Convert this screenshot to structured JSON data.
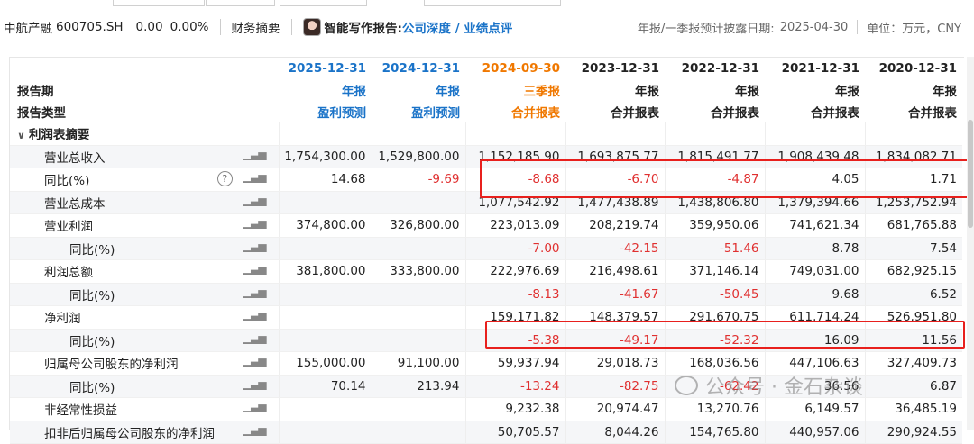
{
  "header": {
    "stock_name": "中航产融",
    "stock_code": "600705.SH",
    "price": "0.00",
    "change_pct": "0.00%",
    "summary_label": "财务摘要",
    "ai_report_label": "智能写作报告:",
    "ai_report_link": "公司深度 / 业绩点评",
    "disclosure_label": "年报/一季报预计披露日期:",
    "disclosure_date": "2025-04-30",
    "unit_label": "单位：万元，CNY"
  },
  "table": {
    "row_labels": {
      "period": "报告期",
      "type": "报告类型"
    },
    "columns": [
      {
        "date": "2025-12-31",
        "period": "年报",
        "type": "盈利预测",
        "color": "#1a73c8"
      },
      {
        "date": "2024-12-31",
        "period": "年报",
        "type": "盈利预测",
        "color": "#1a73c8"
      },
      {
        "date": "2024-09-30",
        "period": "三季报",
        "type": "合并报表",
        "color": "#f07800"
      },
      {
        "date": "2023-12-31",
        "period": "年报",
        "type": "合并报表",
        "color": "#222222"
      },
      {
        "date": "2022-12-31",
        "period": "年报",
        "type": "合并报表",
        "color": "#222222"
      },
      {
        "date": "2021-12-31",
        "period": "年报",
        "type": "合并报表",
        "color": "#222222"
      },
      {
        "date": "2020-12-31",
        "period": "年报",
        "type": "合并报表",
        "color": "#222222"
      }
    ],
    "section_title": "利润表摘要",
    "rows": [
      {
        "label": "营业总收入",
        "indent": 1,
        "values": [
          "1,754,300.00",
          "1,529,800.00",
          "1,152,185.90",
          "1,693,875.77",
          "1,815,491.77",
          "1,908,439.48",
          "1,834,082.71"
        ]
      },
      {
        "label": "同比(%)",
        "indent": 1,
        "help": true,
        "values": [
          "14.68",
          "-9.69",
          "-8.68",
          "-6.70",
          "-4.87",
          "4.05",
          "1.71"
        ]
      },
      {
        "label": "营业总成本",
        "indent": 1,
        "values": [
          "",
          "",
          "1,077,542.92",
          "1,477,438.89",
          "1,438,806.80",
          "1,379,394.66",
          "1,253,752.94"
        ]
      },
      {
        "label": "营业利润",
        "indent": 1,
        "values": [
          "374,800.00",
          "326,800.00",
          "223,013.09",
          "208,219.74",
          "359,950.06",
          "741,621.34",
          "681,765.88"
        ]
      },
      {
        "label": "同比(%)",
        "indent": 2,
        "values": [
          "",
          "",
          "-7.00",
          "-42.15",
          "-51.46",
          "8.78",
          "7.54"
        ]
      },
      {
        "label": "利润总额",
        "indent": 1,
        "values": [
          "381,800.00",
          "333,800.00",
          "222,976.69",
          "216,498.61",
          "371,146.14",
          "749,031.00",
          "682,925.15"
        ]
      },
      {
        "label": "同比(%)",
        "indent": 2,
        "values": [
          "",
          "",
          "-8.13",
          "-41.67",
          "-50.45",
          "9.68",
          "6.52"
        ]
      },
      {
        "label": "净利润",
        "indent": 1,
        "values": [
          "",
          "",
          "159,171.82",
          "148,379.57",
          "291,670.75",
          "611,714.24",
          "526,951.80"
        ]
      },
      {
        "label": "同比(%)",
        "indent": 2,
        "values": [
          "",
          "",
          "-5.38",
          "-49.17",
          "-52.32",
          "16.09",
          "11.56"
        ]
      },
      {
        "label": "归属母公司股东的净利润",
        "indent": 1,
        "values": [
          "155,000.00",
          "91,100.00",
          "59,937.94",
          "29,018.73",
          "168,036.56",
          "447,106.63",
          "327,409.73"
        ]
      },
      {
        "label": "同比(%)",
        "indent": 2,
        "values": [
          "70.14",
          "213.94",
          "-13.24",
          "-82.75",
          "-62.42",
          "36.56",
          "6.87"
        ]
      },
      {
        "label": "非经常性损益",
        "indent": 1,
        "values": [
          "",
          "",
          "9,232.38",
          "20,974.47",
          "13,270.76",
          "6,149.57",
          "36,485.19"
        ]
      },
      {
        "label": "扣非后归属母公司股东的净利润",
        "indent": 1,
        "values": [
          "",
          "",
          "50,705.57",
          "8,044.26",
          "154,765.80",
          "440,957.06",
          "290,924.55"
        ]
      }
    ]
  },
  "watermark": "公众号 · 金石杂谈",
  "colors": {
    "positive": "#222222",
    "negative": "#e03030",
    "highlight_box": "#e8201d"
  }
}
